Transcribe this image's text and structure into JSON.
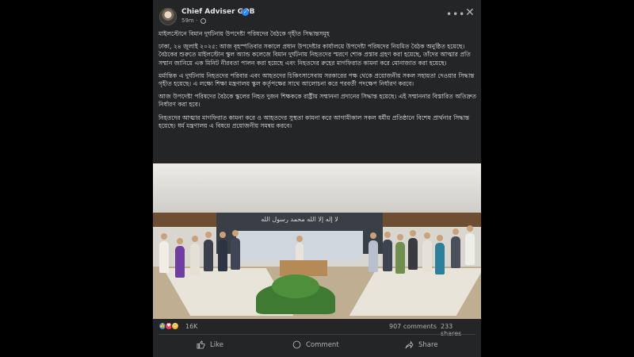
{
  "post": {
    "author": "Chief Adviser GOB",
    "time": "59m",
    "title": "মাইলস্টোনে বিমান দুর্ঘটনায় উপদেষ্টা পরিষদের বৈঠকে গৃহীত সিদ্ধান্তসমূহ",
    "paragraphs": [
      "ঢাকা, ২৪ জুলাই ২০২৫: আজ বৃহস্পতিবার সকালে প্রধান উপদেষ্টার কার্যালয়ে উপদেষ্টা পরিষদের নিয়মিত বৈঠক অনুষ্ঠিত হয়েছে। বৈঠকের শুরুতে মাইলস্টোন স্কুল অ্যান্ড কলেজে বিমান দুর্ঘটনায় নিহতদের স্মরণে শোক প্রস্তাব গ্রহণ করা হয়েছে, তাঁদের আত্মার প্রতি সম্মান জানিয়ে এক মিনিট নীরবতা পালন করা হয়েছে এবং নিহতদের রুহের মাগফিরাত কামনা করে মোনাজাত করা হয়েছে।",
      "মর্মান্তিক এ দুর্ঘটনায় নিহতদের পরিবার এবং আহতদের চিকিৎসাসেবায় সরকারের পক্ষ থেকে প্রয়োজনীয় সকল সহায়তা দেওয়ার সিদ্ধান্ত গৃহীত হয়েছে। এ লক্ষ্যে শিক্ষা মন্ত্রণালয় স্কুল কর্তৃপক্ষের সাথে আলোচনা করে পরবর্তী পদক্ষেপ নির্ধারণ করবে।",
      "আজ উপদেষ্টা পরিষদের বৈঠকে স্কুলের নিহত দুজন শিক্ষককে রাষ্ট্রীয় সম্মাননা প্রদানের সিদ্ধান্ত হয়েছে। এই সম্মাননার বিস্তারিত অতিদ্রুত নির্ধারণ করা হবে।",
      "নিহতদের আত্মার মাগফিরাত কামনা করে ও আহতদের সুস্থতা কামনা করে আগামীকাল সকল ধর্মীয় প্রতিষ্ঠানে বিশেষ প্রার্থনার সিদ্ধান্ত হয়েছে। ধর্ম মন্ত্রণালয় এ বিষয়ে প্রয়োজনীয় সমন্বয় করবে।"
    ],
    "photo_wall_text": "لا إله إلا الله محمد رسول الله"
  },
  "stats": {
    "reactions": "16K",
    "comments": "907 comments",
    "shares": "233 shares"
  },
  "actions": {
    "like": "Like",
    "comment": "Comment",
    "share": "Share"
  },
  "icons": {
    "more": "more-icon",
    "close": "close-icon",
    "like_reaction": "like-icon",
    "love_reaction": "love-icon",
    "care_reaction": "care-icon"
  },
  "colors": {
    "card_bg": "#242526",
    "text": "#e4e6eb",
    "muted": "#b0b3b8",
    "verified": "#2d88ff",
    "like": "#2d88ff",
    "love": "#f33e58",
    "care": "#f7b125"
  }
}
